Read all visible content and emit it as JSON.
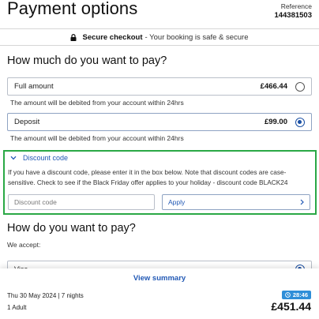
{
  "header": {
    "title": "Payment options",
    "reference_label": "Reference",
    "reference_value": "144381503"
  },
  "secure_bar": {
    "strong": "Secure checkout",
    "rest": "- Your booking is safe & secure"
  },
  "amount_section": {
    "heading": "How much do you want to pay?",
    "options": [
      {
        "label": "Full amount",
        "price": "£466.44",
        "selected": false,
        "note": "The amount will be debited from your account within 24hrs"
      },
      {
        "label": "Deposit",
        "price": "£99.00",
        "selected": true,
        "note": "The amount will be debited from your account within 24hrs"
      }
    ]
  },
  "discount": {
    "toggle_label": "Discount code",
    "description": "If you have a discount code, please enter it in the box below. Note that discount codes are case-sensitive. Check to see if the Black Friday offer applies to your holiday - discount code BLACK24",
    "input_placeholder": "Discount code",
    "input_value": "",
    "apply_label": "Apply",
    "highlight_color": "#2aa845"
  },
  "pay_section": {
    "heading": "How do you want to pay?",
    "accept_label": "We accept:",
    "partial_option": "Visa"
  },
  "footer": {
    "view_summary": "View summary",
    "trip_dates": "Thu 30 May 2024 | 7 nights",
    "travellers": "1 Adult",
    "timer": "28:46",
    "total": "£451.44"
  },
  "colors": {
    "accent": "#2259b5",
    "timer_badge": "#2f8ed8"
  }
}
